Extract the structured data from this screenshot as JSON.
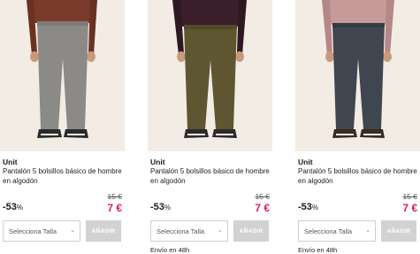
{
  "products": [
    {
      "brand": "Unit",
      "title": "Pantalón 5 bolsillos básico de hombre en algodón",
      "old_price": "15 €",
      "discount_value": "-53",
      "discount_unit": "%",
      "price": "7 €",
      "size_placeholder": "Selecciona Talla",
      "add_label": "AÑADIR",
      "delivery": "",
      "image": {
        "shirt_color": "#7a3b2a",
        "pants_color": "#8c8a86",
        "background": "#f3ece5"
      }
    },
    {
      "brand": "Unit",
      "title": "Pantalón 5 bolsillos básico de hombre en algodón",
      "old_price": "15 €",
      "discount_value": "-53",
      "discount_unit": "%",
      "price": "7 €",
      "size_placeholder": "Selecciona Talla",
      "add_label": "AÑADIR",
      "delivery": "Envío en 48h",
      "image": {
        "shirt_color": "#3a1f2a",
        "pants_color": "#5e5630",
        "background": "#f3ece5"
      }
    },
    {
      "brand": "Unit",
      "title": "Pantalón 5 bolsillos básico de hombre en algodón",
      "old_price": "15 €",
      "discount_value": "-53",
      "discount_unit": "%",
      "price": "7 €",
      "size_placeholder": "Selecciona Talla",
      "add_label": "AÑADIR",
      "delivery": "Envío en 48h",
      "image": {
        "shirt_color": "#c79a9a",
        "pants_color": "#3f4650",
        "background": "#f3ece5"
      }
    }
  ],
  "colors": {
    "price": "#e4185f",
    "button_disabled": "#d2d2d2"
  },
  "icons": {
    "select_caret": "chevron-down-icon"
  }
}
